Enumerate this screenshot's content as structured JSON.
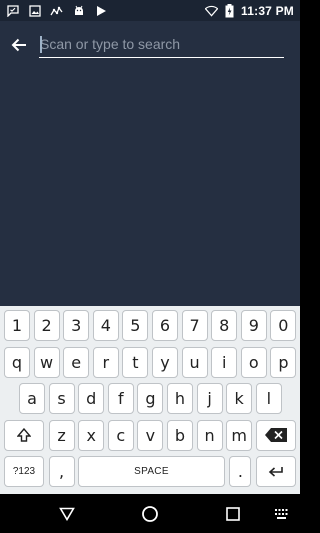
{
  "status_bar": {
    "time": "11:37 PM",
    "notification_icons": [
      "chat-icon",
      "image-icon",
      "activity-icon",
      "android-icon",
      "play-store-icon"
    ],
    "system_icons": [
      "wifi-icon",
      "battery-charging-icon"
    ]
  },
  "search": {
    "placeholder": "Scan or type to search",
    "value": ""
  },
  "keyboard": {
    "numbers": [
      "1",
      "2",
      "3",
      "4",
      "5",
      "6",
      "7",
      "8",
      "9",
      "0"
    ],
    "row1": [
      "q",
      "w",
      "e",
      "r",
      "t",
      "y",
      "u",
      "i",
      "o",
      "p"
    ],
    "row2": [
      "a",
      "s",
      "d",
      "f",
      "g",
      "h",
      "j",
      "k",
      "l"
    ],
    "row3": [
      "z",
      "x",
      "c",
      "v",
      "b",
      "n",
      "m"
    ],
    "symbols_label": "?123",
    "comma": ",",
    "space_label": "SPACE",
    "period": "."
  },
  "colors": {
    "app_background": "#252f41",
    "status_bar": "#1b2433",
    "keyboard_background": "#eceff1",
    "key_background": "#ffffff"
  }
}
